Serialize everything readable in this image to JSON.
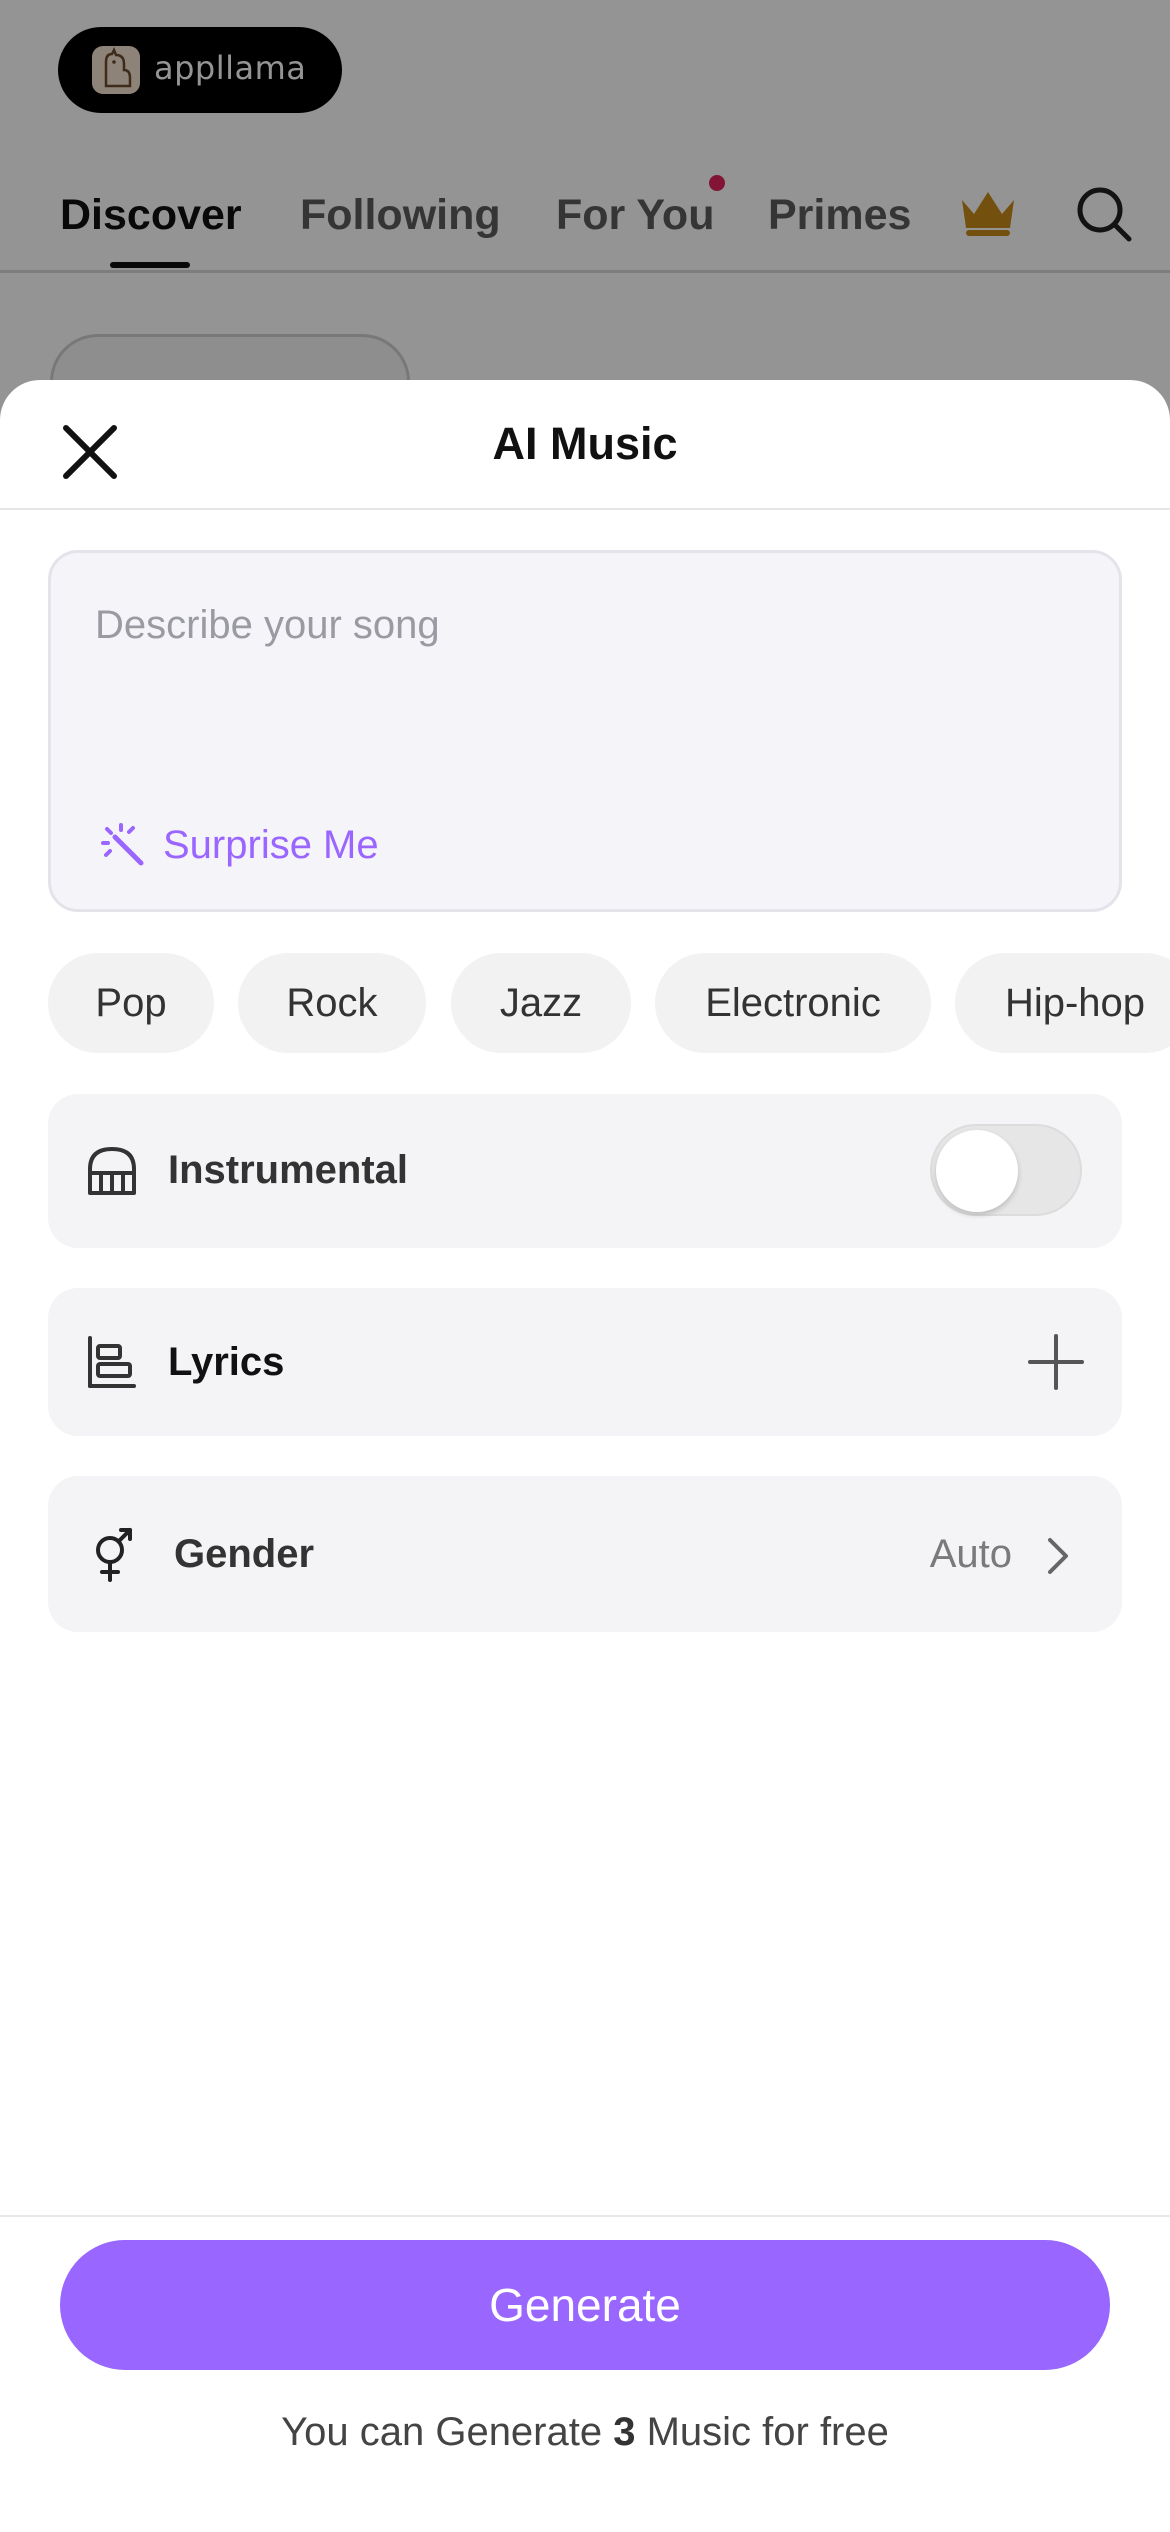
{
  "background_app": {
    "logo_text": "appllama",
    "tabs": [
      {
        "label": "Discover",
        "active": true
      },
      {
        "label": "Following",
        "active": false
      },
      {
        "label": "For You",
        "active": false,
        "has_dot": true
      },
      {
        "label": "Primes",
        "active": false
      }
    ],
    "icons": [
      "crown-icon",
      "search-icon"
    ],
    "accent_colors": {
      "crown": "#9a6a12",
      "notification_dot": "#e0245e"
    }
  },
  "sheet": {
    "title": "AI Music",
    "close_icon": "close-icon",
    "prompt": {
      "placeholder": "Describe your song",
      "value": "",
      "surprise_label": "Surprise Me",
      "surprise_icon": "magic-wand-icon"
    },
    "genres": [
      "Pop",
      "Rock",
      "Jazz",
      "Electronic",
      "Hip-hop"
    ],
    "instrumental": {
      "label": "Instrumental",
      "icon": "piano-icon",
      "enabled": false
    },
    "lyrics": {
      "label": "Lyrics",
      "icon": "lyrics-icon",
      "action_icon": "plus-icon"
    },
    "gender": {
      "label": "Gender",
      "icon": "gender-icon",
      "value": "Auto",
      "action_icon": "chevron-right-icon"
    },
    "generate_label": "Generate",
    "free_note": {
      "prefix": "You can Generate ",
      "count": "3",
      "suffix": " Music for free"
    },
    "accent_color": "#9966ff"
  }
}
